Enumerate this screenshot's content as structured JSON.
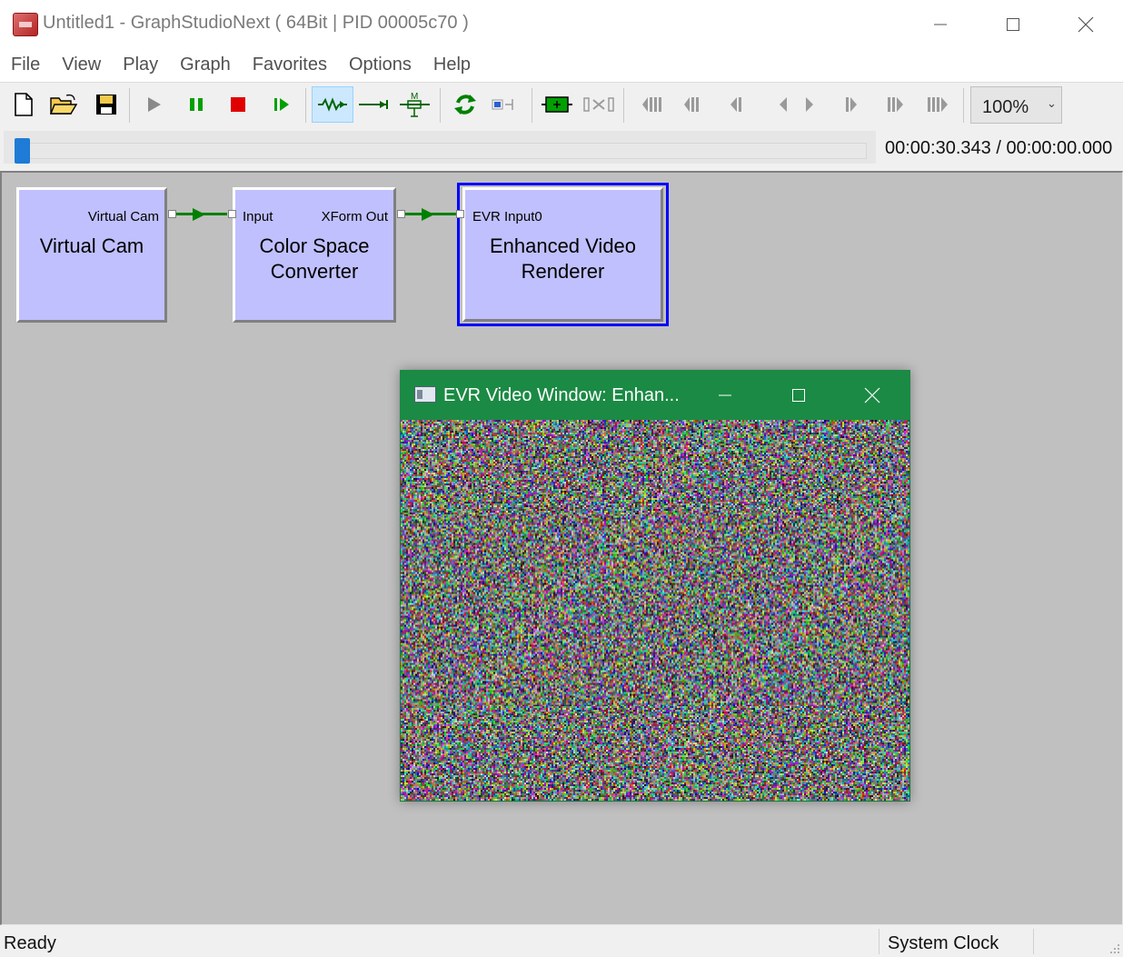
{
  "window": {
    "title": "Untitled1 - GraphStudioNext ( 64Bit | PID 00005c70 )"
  },
  "menu": {
    "items": [
      "File",
      "View",
      "Play",
      "Graph",
      "Favorites",
      "Options",
      "Help"
    ]
  },
  "toolbar": {
    "zoom_value": "100%",
    "buttons": [
      "new-document",
      "open-folder",
      "save",
      "play",
      "pause",
      "stop",
      "step-frame",
      "connect-mode",
      "direct-connect",
      "smart-connect",
      "refresh",
      "properties",
      "add-filter",
      "disconnect",
      "seek-start",
      "seek-back-large",
      "seek-back",
      "frame-back",
      "frame-forward",
      "seek-forward",
      "seek-forward-large",
      "seek-end"
    ]
  },
  "seek": {
    "position_fraction": 0.0,
    "time_text": "00:00:30.343 / 00:00:00.000"
  },
  "graph": {
    "filters": [
      {
        "name_lines": [
          "Virtual Cam"
        ],
        "output_pin": "Virtual Cam"
      },
      {
        "name_lines": [
          "Color Space",
          "Converter"
        ],
        "input_pin": "Input",
        "output_pin": "XForm Out"
      },
      {
        "name_lines": [
          "Enhanced Video",
          "Renderer"
        ],
        "input_pin": "EVR Input0",
        "selected": true
      }
    ],
    "colors": {
      "filter_fill": "#c0c0ff",
      "connection": "#008000",
      "selection": "#0000ff",
      "canvas": "#c0c0c0"
    }
  },
  "video_window": {
    "title": "EVR Video Window: Enhan...",
    "titlebar_color": "#1b8a44"
  },
  "status": {
    "left": "Ready",
    "clock": "System Clock"
  }
}
